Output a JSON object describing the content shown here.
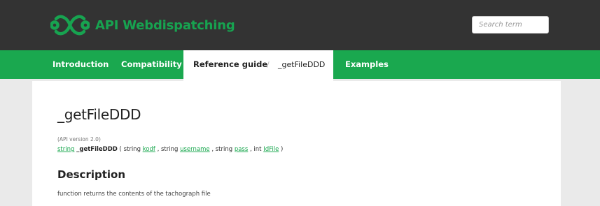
{
  "header": {
    "logo_text": "API Webdispatching",
    "search_placeholder": "Search term"
  },
  "nav": {
    "items": [
      {
        "label": "Introduction"
      },
      {
        "label": "Compatibility"
      },
      {
        "label": "Reference guide"
      },
      {
        "label": "_getFileDDD"
      },
      {
        "label": "Examples"
      }
    ],
    "separator": "/"
  },
  "main": {
    "title": "_getFileDDD",
    "version": "(API version 2.0)",
    "signature": {
      "return_type": "string",
      "function_name": "_getFileDDD",
      "open": "( string",
      "param1": "kodf",
      "mid1": ", string",
      "param2": "username",
      "mid2": ", string",
      "param3": "pass",
      "mid3": ", int",
      "param4": "IdFile",
      "close": ")"
    },
    "description_heading": "Description",
    "description_text": "function returns the contents of the tachograph file"
  },
  "colors": {
    "brand_green": "#1aa84f",
    "header_dark": "#333333",
    "page_bg": "#eaeaea"
  }
}
